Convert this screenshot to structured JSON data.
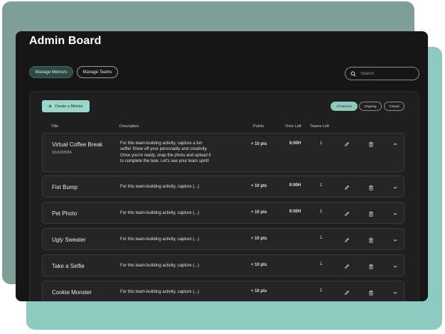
{
  "header": {
    "title": "Admin Board"
  },
  "nav_tabs": [
    {
      "label": "Manage Memors",
      "active": true
    },
    {
      "label": "Manage Teams",
      "active": false
    }
  ],
  "search": {
    "placeholder": "Search",
    "value": "",
    "icon": "search-icon"
  },
  "toolbar": {
    "create_label": "Create a Memor",
    "create_icon": "+"
  },
  "filters": [
    {
      "label": "All Memors",
      "active": true
    },
    {
      "label": "Ongoing",
      "active": false
    },
    {
      "label": "Closed",
      "active": false
    }
  ],
  "table": {
    "columns": [
      "Title",
      "Description",
      "Points",
      "Time Left",
      "Teams Left"
    ],
    "rows": [
      {
        "title": "Virtual Coffee Break",
        "date": "10/12/2024",
        "description_lines": [
          "For this team-building activity, capture a fun",
          "selfie! Show off your personality and creativity.",
          "Once you're ready, snap the photo and upload it",
          "to complete the task. Let's see your team spirit!"
        ],
        "points": "+ 10 pts",
        "time_left": "9:00H",
        "teams_left": "1",
        "expanded": true
      },
      {
        "title": "Fist Bump",
        "description": "For this team-building activity, capture (...)",
        "points": "+ 10 pts",
        "time_left": "9:00H",
        "teams_left": "1",
        "expanded": false
      },
      {
        "title": "Pet Photo",
        "description": "For this team-building activity, capture (...)",
        "points": "+ 10 pts",
        "time_left": "9:00H",
        "teams_left": "1",
        "expanded": false
      },
      {
        "title": "Ugly Sweater",
        "description": "For this team-building activity, capture (...)",
        "points": "+ 10 pts",
        "time_left": "",
        "teams_left": "1",
        "expanded": false
      },
      {
        "title": "Take a Selfie",
        "description": "For this team-building activity, capture (...)",
        "points": "+ 10 pts",
        "time_left": "",
        "teams_left": "1",
        "expanded": false
      },
      {
        "title": "Cookie Monster",
        "description": "For this team-building activity, capture (...)",
        "points": "+ 10 pts",
        "time_left": "",
        "teams_left": "1",
        "expanded": false
      }
    ]
  },
  "colors": {
    "accent": "#8ccac2",
    "active_tab": "#2c4a43",
    "window_bg": "#161616",
    "panel_bg": "#1f1f1f",
    "row_bg": "#252525"
  }
}
